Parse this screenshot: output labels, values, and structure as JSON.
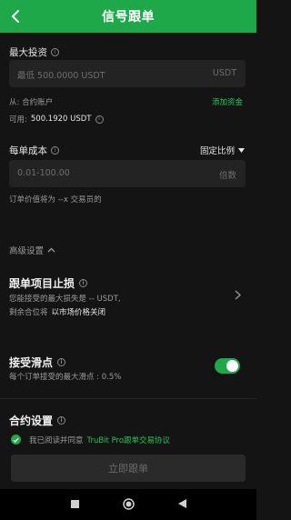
{
  "header": {
    "title": "信号跟单"
  },
  "max_investment": {
    "label": "最大投资",
    "placeholder": "最低 500.0000 USDT",
    "suffix": "USDT",
    "from_label": "从: 合约账户",
    "add_funds": "添加资金",
    "available_label": "可用:",
    "available_value": "500.1920 USDT"
  },
  "per_order_cost": {
    "label": "每单成本",
    "mode": "固定比例",
    "placeholder": "0.01-100.00",
    "suffix": "倍数",
    "note": "订单价值将为 --x 交易员的"
  },
  "advanced": {
    "label": "高级设置"
  },
  "stop_loss": {
    "title": "跟单项目止损",
    "line1": "您能接受的最大损失是 -- USDT,",
    "line2_prefix": "剩余合位将",
    "line2_value": "以市场价格关闭"
  },
  "slippage": {
    "title": "接受滑点",
    "desc": "每个订单接受的最大滑点 : 0.5%",
    "enabled": true
  },
  "contract": {
    "title": "合约设置",
    "agree_prefix": "我已阅读并同意",
    "agree_link": "TruBit Pro跟单交易协议"
  },
  "submit": {
    "label": "立即跟单"
  }
}
